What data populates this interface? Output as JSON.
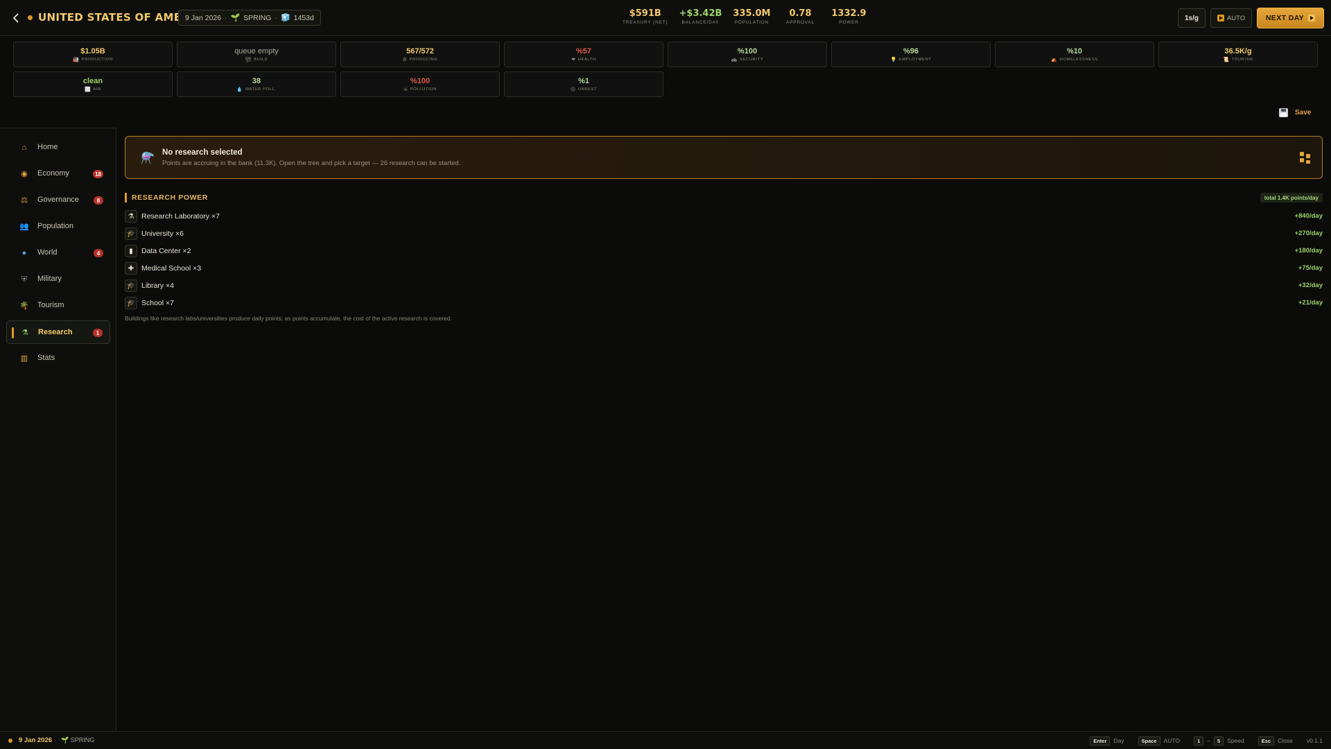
{
  "header": {
    "country": "UNITED STATES OF AMERICA",
    "date": "9 Jan 2026",
    "season": "SPRING",
    "days": "1453d",
    "stats": [
      {
        "value": "$591B",
        "label": "TREASURY (NET)",
        "tone": "gold"
      },
      {
        "value": "+$3.42B",
        "label": "BALANCE/DAY",
        "tone": "green"
      },
      {
        "value": "335.0M",
        "label": "POPULATION",
        "tone": "gold"
      },
      {
        "value": "0.78",
        "label": "APPROVAL",
        "tone": "gold"
      },
      {
        "value": "1332.9",
        "label": "POWER",
        "tone": "gold"
      }
    ],
    "speed_label": "1s/g",
    "auto_label": "AUTO",
    "next_day_label": "NEXT DAY"
  },
  "kpis": [
    {
      "value": "$1.05B",
      "label": "PRODUCTION",
      "icon": "factory-icon",
      "glyph": "🏭",
      "tone": "gold"
    },
    {
      "value": "queue empty",
      "label": "BUILD",
      "icon": "build-icon",
      "glyph": "🏗",
      "tone": "muted"
    },
    {
      "value": "567/572",
      "label": "PRODUCING",
      "icon": "gear-icon",
      "glyph": "⚙",
      "tone": "gold"
    },
    {
      "value": "%57",
      "label": "HEALTH",
      "icon": "heart-icon",
      "glyph": "❤",
      "tone": "red"
    },
    {
      "value": "%100",
      "label": "SECURITY",
      "icon": "police-car-icon",
      "glyph": "🚓",
      "tone": "sage"
    },
    {
      "value": "%96",
      "label": "EMPLOYMENT",
      "icon": "bulb-icon",
      "glyph": "💡",
      "tone": "sage"
    },
    {
      "value": "%10",
      "label": "HOMELESSNESS",
      "icon": "tent-icon",
      "glyph": "⛺",
      "tone": "sage"
    },
    {
      "value": "36.5K/g",
      "label": "TOURISM",
      "icon": "scroll-icon",
      "glyph": "📜",
      "tone": "gold"
    },
    {
      "value": "clean",
      "label": "AIR",
      "icon": "air-icon",
      "glyph": "⬜",
      "tone": "green"
    },
    {
      "value": "38",
      "label": "WATER POLL.",
      "icon": "droplet-icon",
      "glyph": "💧",
      "tone": "sage"
    },
    {
      "value": "%100",
      "label": "POLLUTION",
      "icon": "pollution-icon",
      "glyph": "☠",
      "tone": "red"
    },
    {
      "value": "%1",
      "label": "UNREST",
      "icon": "face-icon",
      "glyph": "😐",
      "tone": "sage"
    }
  ],
  "save_label": "Save",
  "sidebar": {
    "items": [
      {
        "label": "Home",
        "icon": "home-icon",
        "glyph": "⌂",
        "color": "#d6a36a",
        "badge": ""
      },
      {
        "label": "Economy",
        "icon": "coins-icon",
        "glyph": "◉",
        "color": "#e0a640",
        "badge": "18"
      },
      {
        "label": "Governance",
        "icon": "scales-icon",
        "glyph": "⚖",
        "color": "#e0a640",
        "badge": "8"
      },
      {
        "label": "Population",
        "icon": "people-icon",
        "glyph": "👥",
        "color": "#7fb2d9",
        "badge": ""
      },
      {
        "label": "World",
        "icon": "globe-icon",
        "glyph": "●",
        "color": "#5c9fd0",
        "badge": "4"
      },
      {
        "label": "Military",
        "icon": "shield-icon",
        "glyph": "⛨",
        "color": "#8d9199",
        "badge": ""
      },
      {
        "label": "Tourism",
        "icon": "palm-icon",
        "glyph": "🌴",
        "color": "#7fbf4a",
        "badge": ""
      },
      {
        "label": "Research",
        "icon": "flask-icon",
        "glyph": "⚗",
        "color": "#8fd36a",
        "badge": "1"
      },
      {
        "label": "Stats",
        "icon": "chart-icon",
        "glyph": "▥",
        "color": "#e0a640",
        "badge": ""
      }
    ],
    "active": "Research"
  },
  "banner": {
    "title": "No research selected",
    "subtitle": "Points are accruing in the bank (11.3K). Open the tree and pick a target — 26 research can be started."
  },
  "research_power": {
    "title": "RESEARCH POWER",
    "total": "total 1.4K points/day",
    "rows": [
      {
        "name": "Research Laboratory ×7",
        "value": "+840/day",
        "icon": "flask-icon",
        "glyph": "⚗"
      },
      {
        "name": "University ×6",
        "value": "+270/day",
        "icon": "graduation-cap-icon",
        "glyph": "🎓"
      },
      {
        "name": "Data Center ×2",
        "value": "+180/day",
        "icon": "server-icon",
        "glyph": "▮"
      },
      {
        "name": "Medical School ×3",
        "value": "+75/day",
        "icon": "medical-icon",
        "glyph": "✚"
      },
      {
        "name": "Library ×4",
        "value": "+32/day",
        "icon": "graduation-cap-icon",
        "glyph": "🎓"
      },
      {
        "name": "School ×7",
        "value": "+21/day",
        "icon": "graduation-cap-icon",
        "glyph": "🎓"
      }
    ],
    "note": "Buildings like research labs/universities produce daily points; as points accumulate, the cost of the active research is covered."
  },
  "footer": {
    "date": "9 Jan 2026",
    "season": "SPRING",
    "keys": [
      {
        "key": "Enter",
        "action": "Day"
      },
      {
        "key": "Space",
        "action": "AUTO"
      },
      {
        "key": "1",
        "sep": "–",
        "key2": "5",
        "action": "Speed"
      },
      {
        "key": "Esc",
        "action": "Close"
      }
    ],
    "version": "v0.1.1"
  }
}
